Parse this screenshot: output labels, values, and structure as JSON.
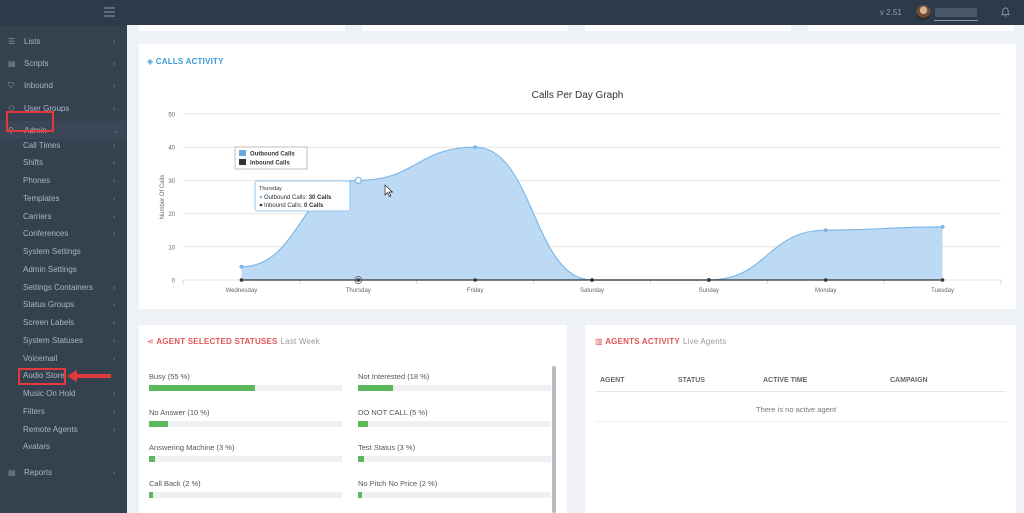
{
  "topbar": {
    "version": "v 2.51"
  },
  "sidebar": {
    "items": [
      {
        "label": "Lists",
        "icon": "list-icon"
      },
      {
        "label": "Scripts",
        "icon": "file-icon"
      },
      {
        "label": "Inbound",
        "icon": "inbound-icon"
      },
      {
        "label": "User Groups",
        "icon": "users-icon"
      },
      {
        "label": "Admin",
        "icon": "user-icon"
      }
    ],
    "admin_sub": [
      {
        "label": "Call Times",
        "chev": true
      },
      {
        "label": "Shifts",
        "chev": true
      },
      {
        "label": "Phones",
        "chev": true
      },
      {
        "label": "Templates",
        "chev": true
      },
      {
        "label": "Carriers",
        "chev": true
      },
      {
        "label": "Conferences",
        "chev": true
      },
      {
        "label": "System Settings",
        "chev": false
      },
      {
        "label": "Admin Settings",
        "chev": false
      },
      {
        "label": "Settings Containers",
        "chev": true
      },
      {
        "label": "Status Groups",
        "chev": true
      },
      {
        "label": "Screen Labels",
        "chev": true
      },
      {
        "label": "System Statuses",
        "chev": true
      },
      {
        "label": "Voicemail",
        "chev": true
      },
      {
        "label": "Audio Store",
        "chev": false
      },
      {
        "label": "Music On Hold",
        "chev": true
      },
      {
        "label": "Filters",
        "chev": true
      },
      {
        "label": "Remote Agents",
        "chev": true
      },
      {
        "label": "Avatars",
        "chev": false
      }
    ],
    "reports": {
      "label": "Reports",
      "icon": "report-icon"
    }
  },
  "calls_activity": {
    "title": "CALLS ACTIVITY"
  },
  "chart_data": {
    "type": "area",
    "title": "Calls Per Day Graph",
    "ylabel": "Number Of Calls",
    "xlabel": "",
    "categories": [
      "Wednesday",
      "Thursday",
      "Friday",
      "Saturday",
      "Sunday",
      "Monday",
      "Tuesday"
    ],
    "ylim": [
      0,
      50
    ],
    "yticks": [
      0,
      10,
      20,
      30,
      40,
      50
    ],
    "series": [
      {
        "name": "Outbound Calls",
        "values": [
          4,
          30,
          40,
          0,
          0,
          15,
          16
        ],
        "color": "#7fb8e8"
      },
      {
        "name": "Inbound Calls",
        "values": [
          0,
          0,
          0,
          0,
          0,
          0,
          0
        ],
        "color": "#333333"
      }
    ],
    "legend": "top-left",
    "grid": true,
    "tooltip": {
      "day": "Thursday",
      "line1_label": "Outbound Calls:",
      "line1_value": "30 Calls",
      "line2_label": "Inbound Calls:",
      "line2_value": "0 Calls"
    }
  },
  "agent_statuses": {
    "title": "AGENT SELECTED STATUSES",
    "subtitle": "Last Week",
    "items": [
      {
        "label": "Busy (55 %)",
        "percent": 55
      },
      {
        "label": "Not Interested (18 %)",
        "percent": 18
      },
      {
        "label": "No Answer (10 %)",
        "percent": 10
      },
      {
        "label": "DO NOT CALL (5 %)",
        "percent": 5
      },
      {
        "label": "Answering Machine (3 %)",
        "percent": 3
      },
      {
        "label": "Test Status (3 %)",
        "percent": 3
      },
      {
        "label": "Call Back (2 %)",
        "percent": 2
      },
      {
        "label": "No Pitch No Price (2 %)",
        "percent": 2
      }
    ]
  },
  "agents_activity": {
    "title": "AGENTS ACTIVITY",
    "subtitle": "Live Agents",
    "columns": [
      "AGENT",
      "STATUS",
      "ACTIVE TIME",
      "CAMPAIGN"
    ],
    "empty_text": "There is no active agent"
  },
  "colors": {
    "sidebar_bg": "#35414f",
    "topbar_bg": "#2c3a4a",
    "accent_blue": "#3a9ad9",
    "accent_red": "#e05555",
    "bar_green": "#5cb85c",
    "highlight": "#e03a3a"
  }
}
